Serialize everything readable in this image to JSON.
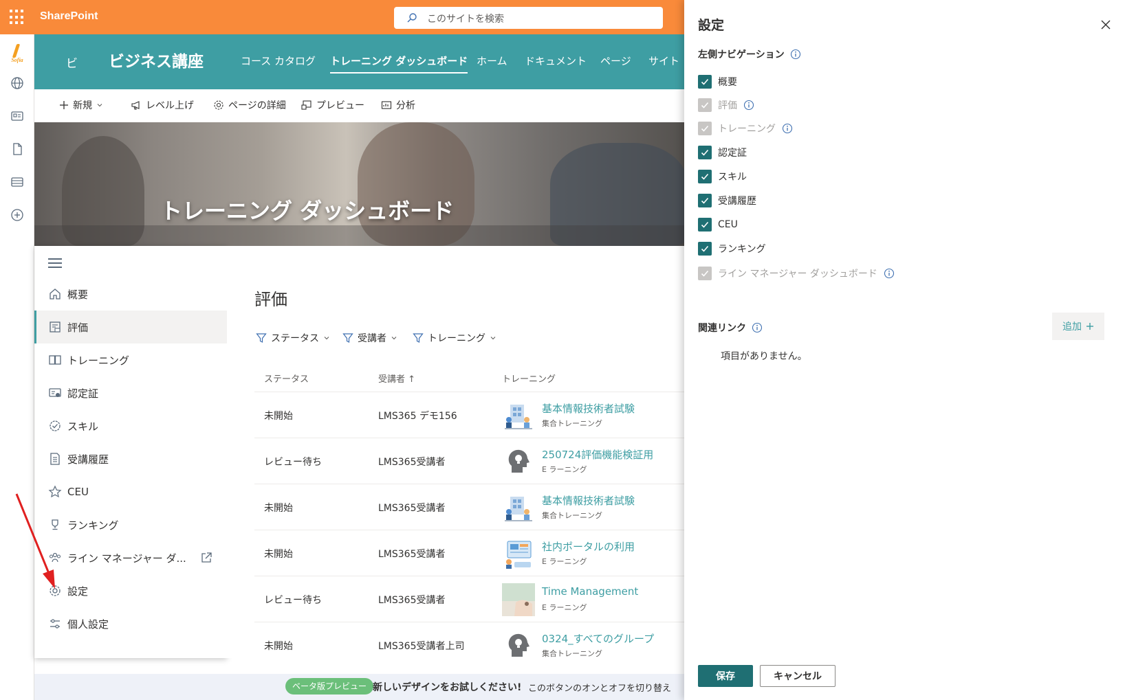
{
  "suite": {
    "brand": "SharePoint",
    "search_placeholder": "このサイトを検索"
  },
  "appbar": {
    "logo_text": "Sofia"
  },
  "site": {
    "logo": "ビ",
    "title": "ビジネス講座",
    "nav": [
      "コース カタログ",
      "トレーニング ダッシュボード",
      "ホーム",
      "ドキュメント",
      "ページ",
      "サイト"
    ],
    "active_nav": "トレーニング ダッシュボード"
  },
  "command_bar": {
    "new": "新規",
    "promote": "レベル上げ",
    "page_details": "ページの詳細",
    "preview": "プレビュー",
    "analytics": "分析"
  },
  "hero": {
    "title": "トレーニング ダッシュボード"
  },
  "left_nav": {
    "items": [
      {
        "label": "概要",
        "icon": "home-icon"
      },
      {
        "label": "評価",
        "icon": "evaluation-icon"
      },
      {
        "label": "トレーニング",
        "icon": "book-icon"
      },
      {
        "label": "認定証",
        "icon": "certificate-icon"
      },
      {
        "label": "スキル",
        "icon": "skill-badge-icon"
      },
      {
        "label": "受講履歴",
        "icon": "document-list-icon"
      },
      {
        "label": "CEU",
        "icon": "star-icon"
      },
      {
        "label": "ランキング",
        "icon": "trophy-icon"
      },
      {
        "label": "ライン マネージャー ダ...",
        "icon": "people-icon"
      },
      {
        "label": "設定",
        "icon": "gear-icon"
      },
      {
        "label": "個人設定",
        "icon": "sliders-icon"
      }
    ],
    "selected": "評価"
  },
  "main": {
    "title": "評価",
    "filters": [
      "ステータス",
      "受講者",
      "トレーニング"
    ],
    "columns": [
      "ステータス",
      "受講者 ↑",
      "トレーニング"
    ],
    "rows": [
      {
        "status": "未開始",
        "learner": "LMS365 デモ156",
        "training": "基本情報技術者試験",
        "type": "集合トレーニング",
        "thumb": "office-illustration"
      },
      {
        "status": "レビュー待ち",
        "learner": "LMS365受講者",
        "training": "250724評価機能検証用",
        "type": "E ラーニング",
        "thumb": "lightbulb-head"
      },
      {
        "status": "未開始",
        "learner": "LMS365受講者",
        "training": "基本情報技術者試験",
        "type": "集合トレーニング",
        "thumb": "office-illustration"
      },
      {
        "status": "未開始",
        "learner": "LMS365受講者",
        "training": "社内ポータルの利用",
        "type": "E ラーニング",
        "thumb": "dashboard-illustration"
      },
      {
        "status": "レビュー待ち",
        "learner": "LMS365受講者",
        "training": "Time Management",
        "type": "E ラーニング",
        "thumb": "photo"
      },
      {
        "status": "未開始",
        "learner": "LMS365受講者上司",
        "training": "0324_すべてのグループ",
        "type": "集合トレーニング",
        "thumb": "lightbulb-head"
      }
    ]
  },
  "beta_bar": {
    "badge": "ベータ版プレビュー",
    "strong": "新しいデザインをお試しください!",
    "text": "このボタンのオンとオフを切り替え"
  },
  "settings_panel": {
    "title": "設定",
    "left_nav_section": "左側ナビゲーション",
    "items": [
      {
        "label": "概要",
        "checked": true,
        "disabled": false,
        "info": false
      },
      {
        "label": "評価",
        "checked": true,
        "disabled": true,
        "info": true
      },
      {
        "label": "トレーニング",
        "checked": true,
        "disabled": true,
        "info": true
      },
      {
        "label": "認定証",
        "checked": true,
        "disabled": false,
        "info": false
      },
      {
        "label": "スキル",
        "checked": true,
        "disabled": false,
        "info": false
      },
      {
        "label": "受講履歴",
        "checked": true,
        "disabled": false,
        "info": false
      },
      {
        "label": "CEU",
        "checked": true,
        "disabled": false,
        "info": false
      },
      {
        "label": "ランキング",
        "checked": true,
        "disabled": false,
        "info": false
      },
      {
        "label": "ライン マネージャー ダッシュボード",
        "checked": true,
        "disabled": true,
        "info": true
      }
    ],
    "related_links_section": "関連リンク",
    "add_label": "追加",
    "empty_message": "項目がありません。",
    "save_label": "保存",
    "cancel_label": "キャンセル"
  },
  "colors": {
    "suite_bar": "#f98a3a",
    "site_header": "#3e9ea3",
    "link": "#3e9ea3",
    "checkbox": "#1f6f73",
    "beta_badge": "#6bbf7a",
    "annotation_arrow": "#e02020"
  }
}
